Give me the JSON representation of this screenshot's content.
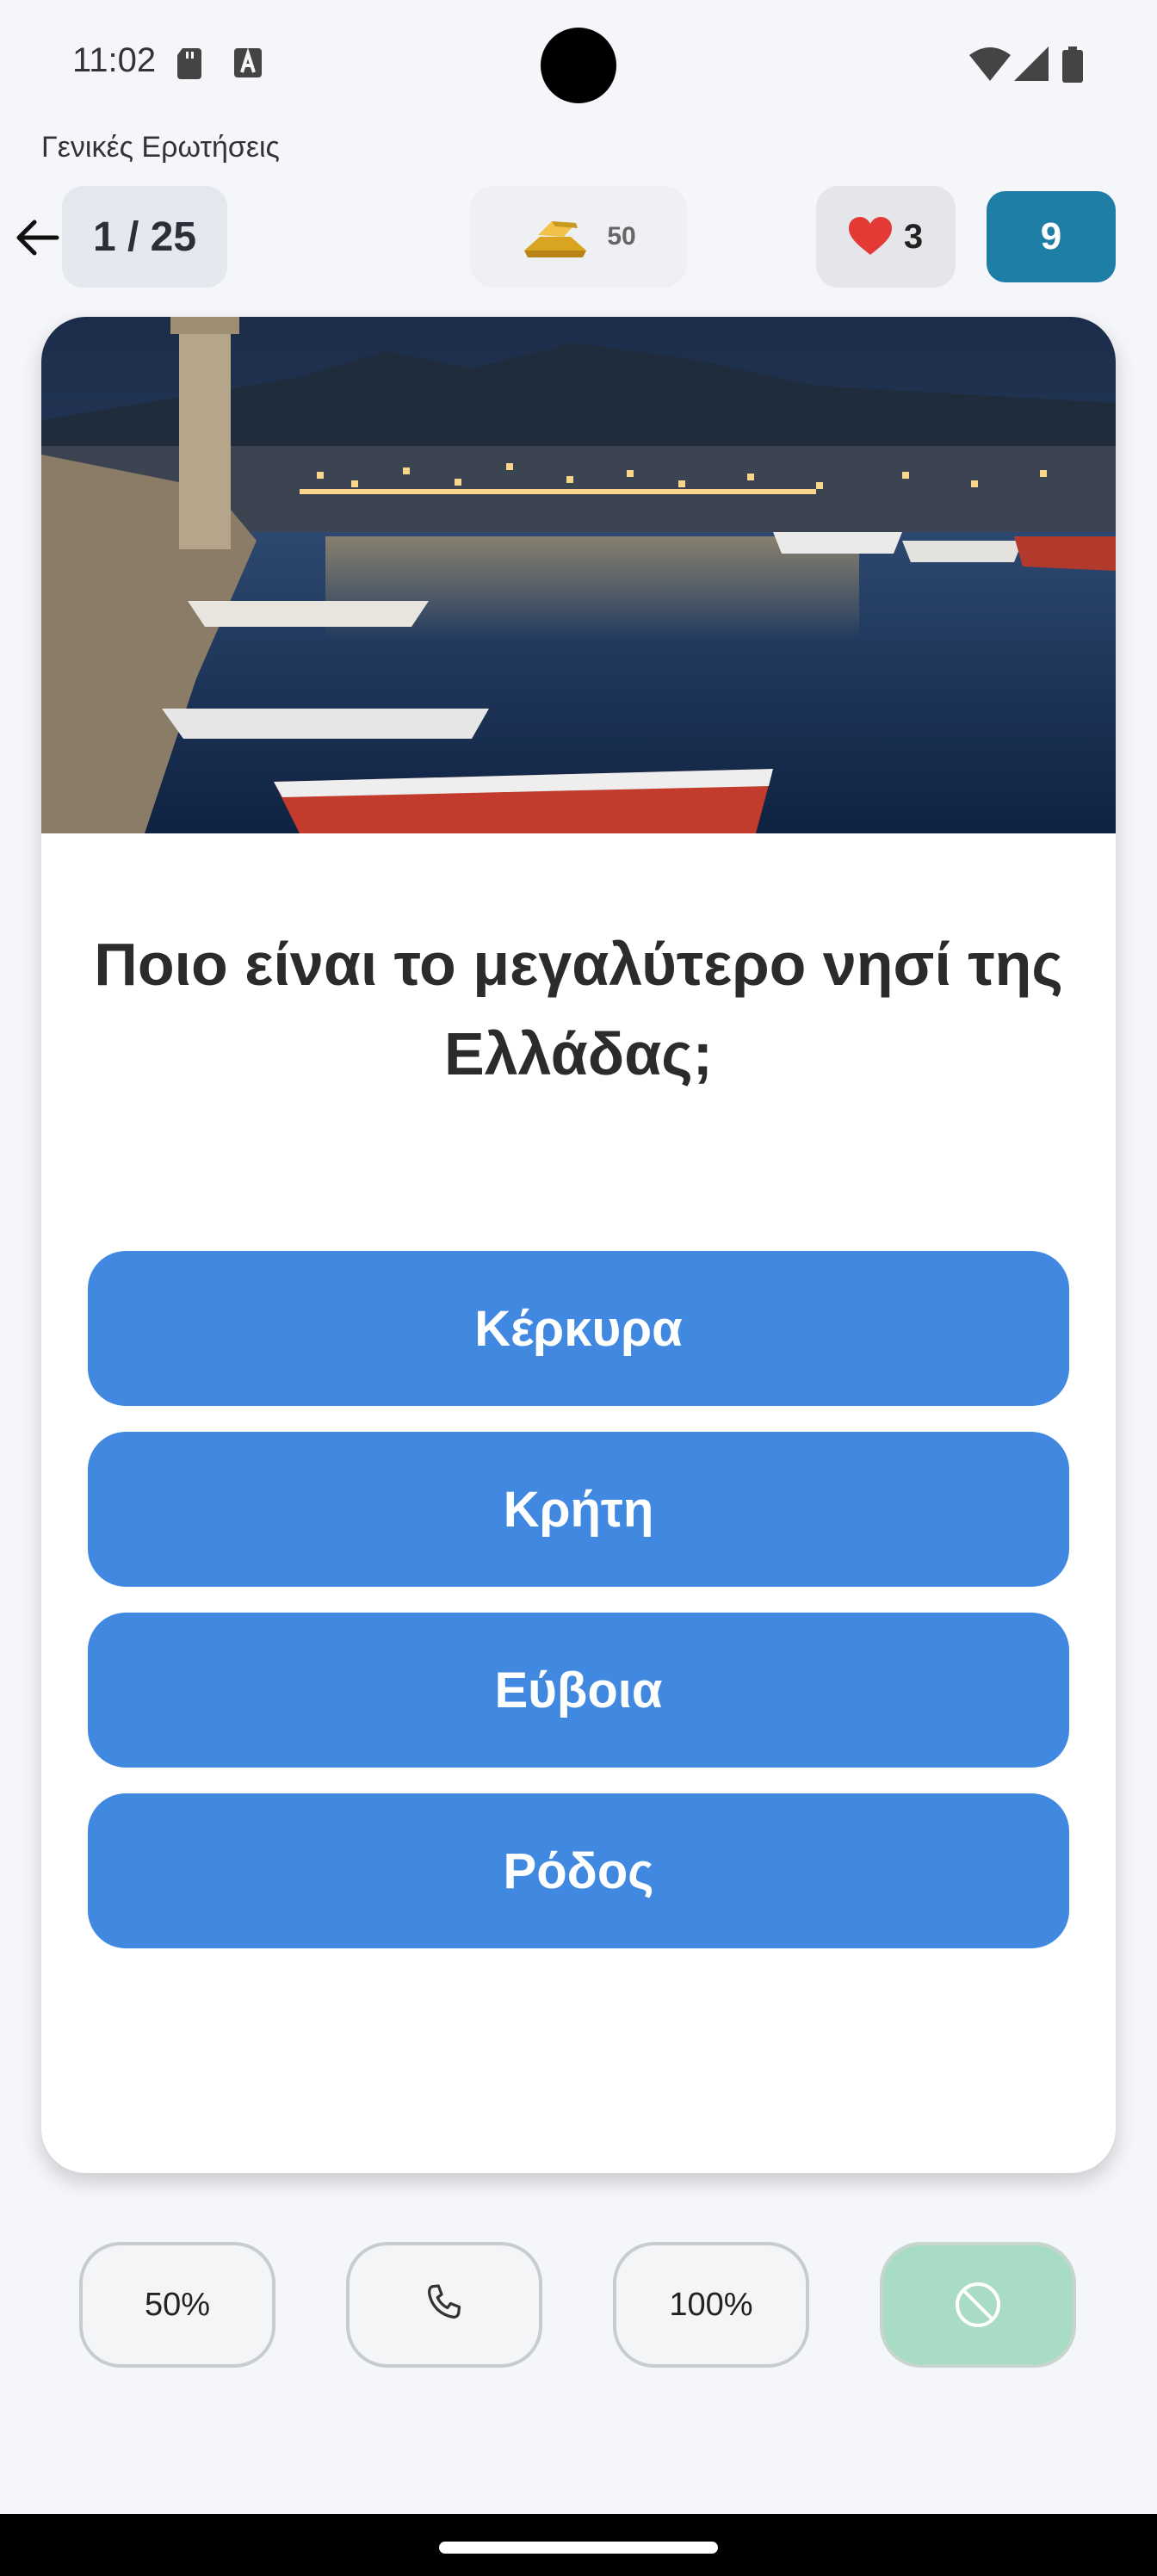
{
  "status_bar": {
    "time": "11:02"
  },
  "category": {
    "title": "Γενικές Ερωτήσεις"
  },
  "top_bar": {
    "progress": "1 / 25",
    "gold": "50",
    "lives": "3",
    "score": "9"
  },
  "question": {
    "text": "Ποιο είναι το μεγαλύτερο νησί της Ελλάδας;",
    "answers": [
      "Κέρκυρα",
      "Κρήτη",
      "Εύβοια",
      "Ρόδος"
    ]
  },
  "lifelines": {
    "fifty": "50%",
    "hundred": "100%"
  },
  "colors": {
    "answer_bg": "#4189e0",
    "score_bg": "#1f7ea6",
    "skip_bg": "#a8dcc4"
  },
  "icons": [
    "sd-card-icon",
    "a-keyboard-icon",
    "wifi-icon",
    "signal-icon",
    "battery-icon",
    "back-arrow-icon",
    "gold-bars-icon",
    "heart-icon",
    "phone-icon",
    "block-icon"
  ]
}
